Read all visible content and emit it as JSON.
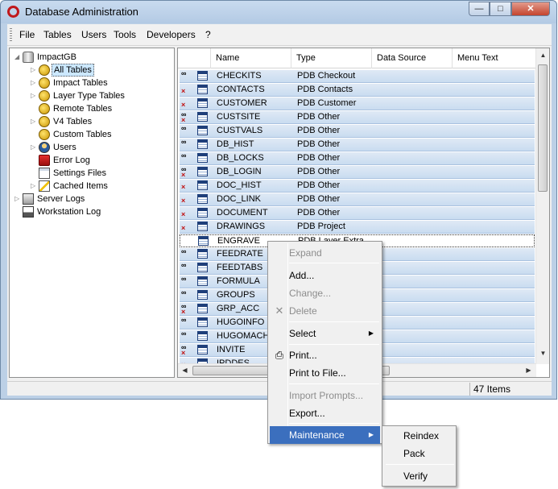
{
  "window": {
    "title": "Database Administration",
    "min_glyph": "—",
    "max_glyph": "□",
    "close_glyph": "✕"
  },
  "menubar": {
    "items": [
      "File",
      "Tables",
      "Users",
      "Tools",
      "Developers",
      "?"
    ]
  },
  "tree": {
    "root": "ImpactGB",
    "children": [
      {
        "label": "All Tables",
        "icon": "coins-icon",
        "selected": true
      },
      {
        "label": "Impact Tables",
        "icon": "coins-icon"
      },
      {
        "label": "Layer Type Tables",
        "icon": "coins-icon"
      },
      {
        "label": "Remote Tables",
        "icon": "coins-icon"
      },
      {
        "label": "V4 Tables",
        "icon": "coins-icon"
      },
      {
        "label": "Custom Tables",
        "icon": "coins-icon"
      },
      {
        "label": "Users",
        "icon": "users-icon"
      },
      {
        "label": "Error Log",
        "icon": "error-log-icon"
      },
      {
        "label": "Settings Files",
        "icon": "settings-file-icon"
      },
      {
        "label": "Cached Items",
        "icon": "cached-items-icon"
      }
    ],
    "server_logs": "Server Logs",
    "workstation_log": "Workstation Log"
  },
  "grid": {
    "columns": [
      "Name",
      "Type",
      "Data Source",
      "Menu Text"
    ],
    "rows": [
      {
        "name": "CHECKITS",
        "type": "PDB Checkout",
        "status": "glasses"
      },
      {
        "name": "CONTACTS",
        "type": "PDB Contacts",
        "status": "x"
      },
      {
        "name": "CUSTOMER",
        "type": "PDB Customer",
        "status": "x"
      },
      {
        "name": "CUSTSITE",
        "type": "PDB Other",
        "status": "glasses-x"
      },
      {
        "name": "CUSTVALS",
        "type": "PDB Other",
        "status": "glasses"
      },
      {
        "name": "DB_HIST",
        "type": "PDB Other",
        "status": "glasses"
      },
      {
        "name": "DB_LOCKS",
        "type": "PDB Other",
        "status": "glasses"
      },
      {
        "name": "DB_LOGIN",
        "type": "PDB Other",
        "status": "glasses-x"
      },
      {
        "name": "DOC_HIST",
        "type": "PDB Other",
        "status": "x"
      },
      {
        "name": "DOC_LINK",
        "type": "PDB Other",
        "status": "x"
      },
      {
        "name": "DOCUMENT",
        "type": "PDB Other",
        "status": "x"
      },
      {
        "name": "DRAWINGS",
        "type": "PDB Project",
        "status": "x"
      },
      {
        "name": "ENGRAVE",
        "type": "PDB Layer Extra",
        "status": "",
        "focus": true
      },
      {
        "name": "FEEDRATE",
        "type": "",
        "status": "glasses"
      },
      {
        "name": "FEEDTABS",
        "type": "",
        "status": "glasses"
      },
      {
        "name": "FORMULA",
        "type": "",
        "status": "glasses"
      },
      {
        "name": "GROUPS",
        "type": "",
        "status": "glasses"
      },
      {
        "name": "GRP_ACC",
        "type": "",
        "status": "glasses-x"
      },
      {
        "name": "HUGOINFO",
        "type": "",
        "status": "glasses"
      },
      {
        "name": "HUGOMACH",
        "type": "",
        "status": "glasses"
      },
      {
        "name": "INVITE",
        "type": "",
        "status": "glasses-x"
      },
      {
        "name": "IPDDES",
        "type": "",
        "status": "x"
      }
    ]
  },
  "status": {
    "count": "47 Items"
  },
  "context_menu": {
    "expand": "Expand",
    "add": "Add...",
    "change": "Change...",
    "delete": "Delete",
    "select": "Select",
    "print": "Print...",
    "print_to_file": "Print to File...",
    "import_prompts": "Import Prompts...",
    "export": "Export...",
    "maintenance": "Maintenance"
  },
  "submenu": {
    "reindex": "Reindex",
    "pack": "Pack",
    "verify": "Verify"
  },
  "colors": {
    "titlebar": "#bcd0e6",
    "row_fill": "#d5e3f3",
    "menu_highlight": "#3b6fbe",
    "error_x": "#c01010"
  }
}
